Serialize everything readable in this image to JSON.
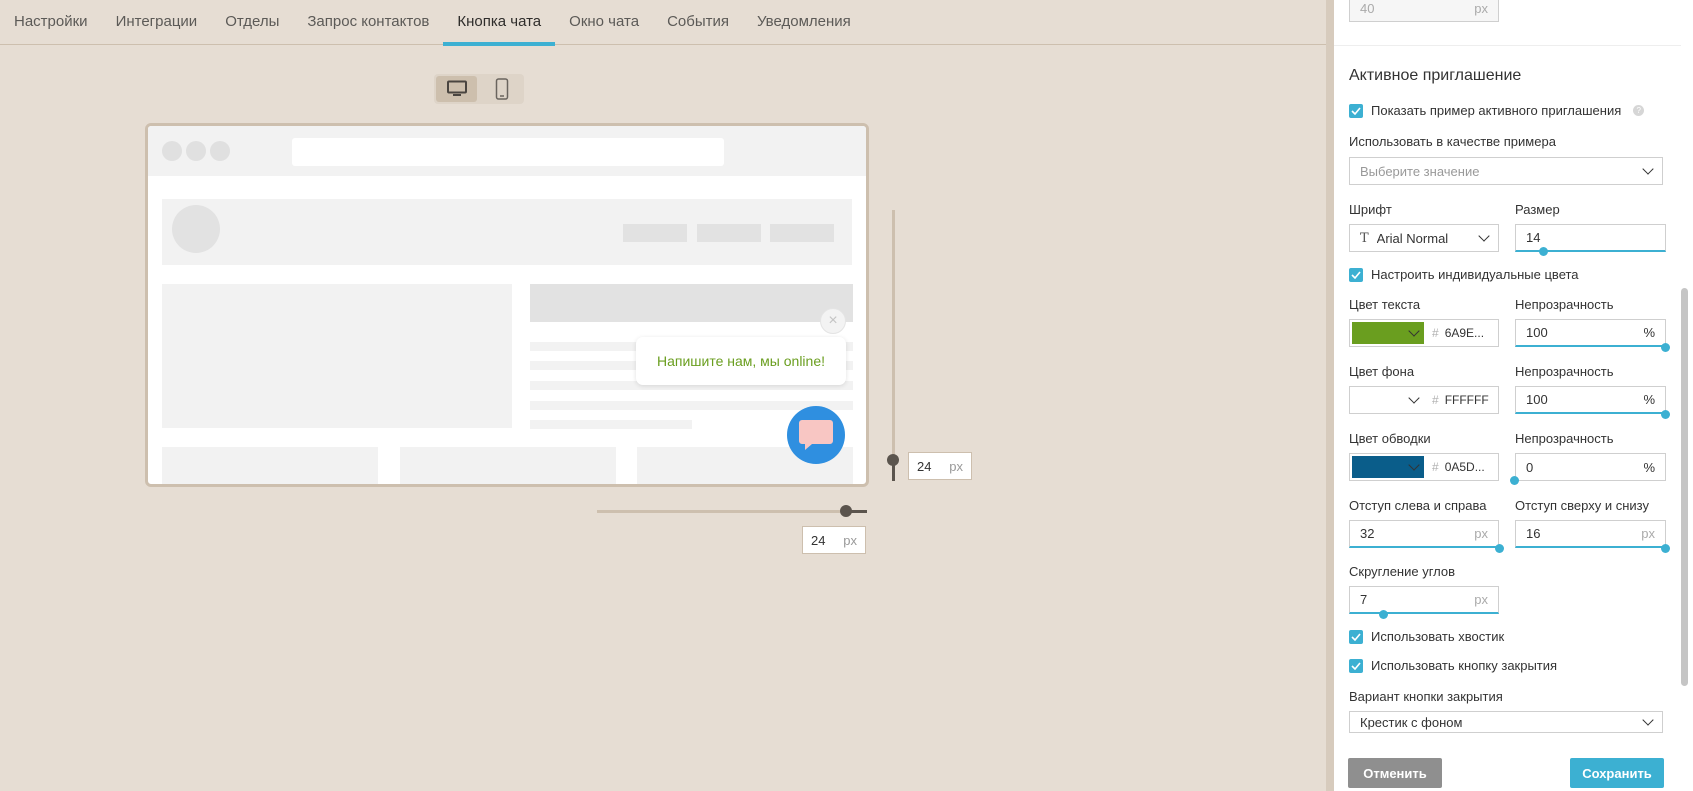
{
  "tabs": [
    "Настройки",
    "Интеграции",
    "Отделы",
    "Запрос контактов",
    "Кнопка чата",
    "Окно чата",
    "События",
    "Уведомления"
  ],
  "active_tab": "Кнопка чата",
  "preview": {
    "invite_text": "Напишите нам, мы online!",
    "vertical_offset": {
      "value": "24",
      "unit": "px"
    },
    "horizontal_offset": {
      "value": "24",
      "unit": "px"
    }
  },
  "panel": {
    "top_field": {
      "value": "40",
      "unit": "px"
    },
    "section_title": "Активное приглашение",
    "show_example_label": "Показать пример активного приглашения",
    "use_as_example_label": "Использовать в качестве примера",
    "use_as_example_placeholder": "Выберите значение",
    "font_label": "Шрифт",
    "font_value": "Arial Normal",
    "size_label": "Размер",
    "size_value": "14",
    "custom_colors_label": "Настроить индивидуальные цвета",
    "text_color_label": "Цвет текста",
    "text_color_hex": "6A9E...",
    "text_color": "#6a9e1f",
    "opacity_label": "Непрозрачность",
    "text_opacity": "100",
    "bg_color_label": "Цвет фона",
    "bg_color_hex": "FFFFFF",
    "bg_opacity": "100",
    "border_color_label": "Цвет обводки",
    "border_color_hex": "0A5D...",
    "border_color": "#0a5d8a",
    "border_opacity": "0",
    "percent_unit": "%",
    "padding_lr_label": "Отступ слева и справа",
    "padding_lr_value": "32",
    "padding_tb_label": "Отступ сверху и снизу",
    "padding_tb_value": "16",
    "px_unit": "px",
    "radius_label": "Скругление углов",
    "radius_value": "7",
    "use_tail_label": "Использовать хвостик",
    "use_close_label": "Использовать кнопку закрытия",
    "close_variant_label": "Вариант кнопки закрытия",
    "close_variant_value": "Крестик с фоном",
    "hash": "#",
    "help_glyph": "?"
  },
  "buttons": {
    "cancel": "Отменить",
    "save": "Сохранить"
  },
  "colors": {
    "accent": "#3cb0d2",
    "cancel_bg": "#8f8f8f",
    "save_bg": "#3cb0d2",
    "chat_button": "#2f8fe0"
  }
}
